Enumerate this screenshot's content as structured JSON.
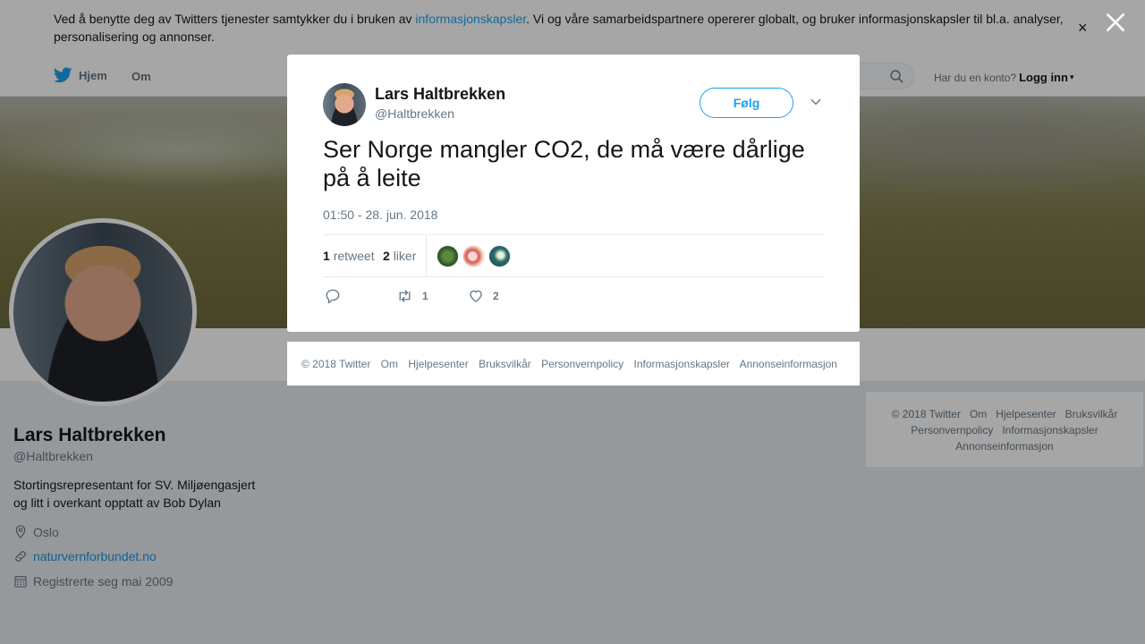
{
  "cookie_banner": {
    "text_before": "Ved å benytte deg av Twitters tjenester samtykker du i bruken av ",
    "link_text": "informasjonskapsler",
    "text_after": ". Vi og våre samarbeidspartnere opererer globalt, og bruker informasjonskapsler til bl.a. analyser, personalisering og annonser.",
    "close_glyph": "×"
  },
  "nav": {
    "home_label": "Hjem",
    "about_label": "Om",
    "login_prompt": "Har du en konto?",
    "login_link": "Logg inn",
    "login_caret": "▾"
  },
  "profile": {
    "name": "Lars Haltbrekken",
    "handle": "@Haltbrekken",
    "bio": "Stortingsrepresentant for SV. Miljøengasjert og litt i overkant opptatt av Bob Dylan",
    "location": "Oslo",
    "url": "naturvernforbundet.no",
    "joined": "Registrerte seg mai 2009"
  },
  "tweet": {
    "author_name": "Lars Haltbrekken",
    "author_handle": "@Haltbrekken",
    "follow_label": "Følg",
    "text": "Ser Norge mangler CO2, de må være dårlige på å leite",
    "timestamp": "01:50 - 28. jun. 2018",
    "retweet_count": "1",
    "retweet_label": "retweet",
    "like_count": "2",
    "like_label": "liker",
    "action_retweet_count": "1",
    "action_like_count": "2"
  },
  "footer": {
    "items": [
      "© 2018 Twitter",
      "Om",
      "Hjelpesenter",
      "Bruksvilkår",
      "Personvernpolicy",
      "Informasjonskapsler",
      "Annonseinformasjon"
    ]
  },
  "colors": {
    "accent": "#1da1f2",
    "link": "#1b95e0",
    "muted": "#657786",
    "overlay": "rgba(0,0,0,0.35)"
  }
}
